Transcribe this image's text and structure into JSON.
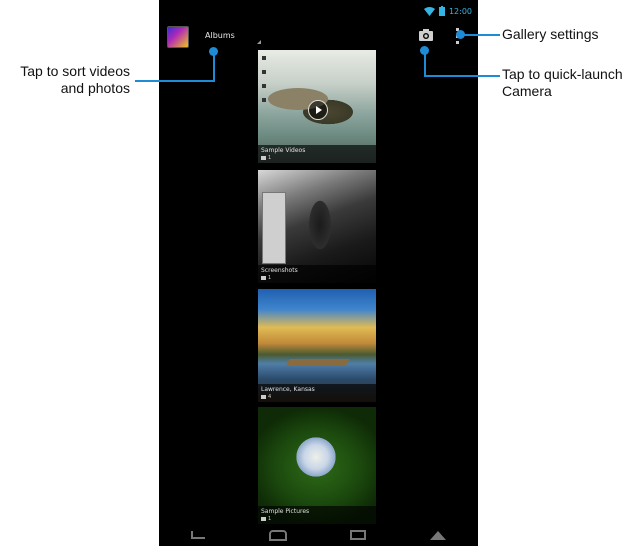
{
  "status_bar": {
    "time": "12:00"
  },
  "action_bar": {
    "title": "Albums"
  },
  "albums": [
    {
      "name": "Sample Videos",
      "count": "1"
    },
    {
      "name": "Screenshots",
      "count": "1"
    },
    {
      "name": "Lawrence, Kansas",
      "count": "4"
    },
    {
      "name": "Sample Pictures",
      "count": "1"
    }
  ],
  "callouts": {
    "sort": [
      "Tap to sort videos",
      "and photos"
    ],
    "settings": "Gallery settings",
    "camera": [
      "Tap to quick-launch",
      "Camera"
    ]
  },
  "colors": {
    "accent": "#1e8bd6",
    "holo_blue": "#33b5e5"
  }
}
